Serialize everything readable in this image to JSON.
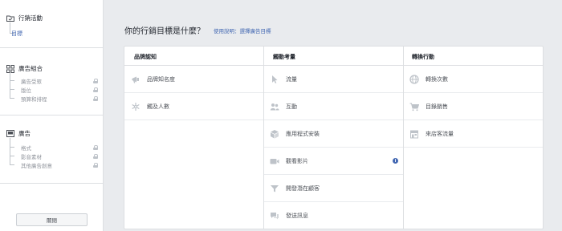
{
  "sidebar": {
    "campaign": {
      "title": "行銷活動",
      "items": [
        {
          "label": "目標"
        }
      ]
    },
    "adset": {
      "title": "廣告組合",
      "items": [
        {
          "label": "廣告受眾"
        },
        {
          "label": "版位"
        },
        {
          "label": "預算和排程"
        }
      ]
    },
    "ad": {
      "title": "廣告",
      "items": [
        {
          "label": "格式"
        },
        {
          "label": "影音素材"
        },
        {
          "label": "其他廣告創意"
        }
      ]
    },
    "close_label": "關閉"
  },
  "main": {
    "heading": "你的行銷目標是什麼？",
    "help_link": "使用說明：選擇廣告目標",
    "columns": [
      {
        "title": "品牌認知",
        "options": [
          {
            "label": "品牌知名度",
            "icon": "megaphone-icon"
          },
          {
            "label": "觸及人數",
            "icon": "snowflake-icon"
          }
        ]
      },
      {
        "title": "觸動考量",
        "options": [
          {
            "label": "流量",
            "icon": "cursor-icon"
          },
          {
            "label": "互動",
            "icon": "people-icon"
          },
          {
            "label": "應用程式安裝",
            "icon": "box-icon"
          },
          {
            "label": "觀看影片",
            "icon": "video-icon"
          },
          {
            "label": "開發潛在顧客",
            "icon": "funnel-icon"
          },
          {
            "label": "發送訊息",
            "icon": "chat-icon"
          }
        ]
      },
      {
        "title": "轉換行動",
        "options": [
          {
            "label": "轉換次數",
            "icon": "globe-icon"
          },
          {
            "label": "目錄銷售",
            "icon": "cart-icon"
          },
          {
            "label": "來店客流量",
            "icon": "store-icon"
          }
        ]
      }
    ],
    "info_icon": "i"
  },
  "colors": {
    "accent": "#4267b2",
    "icon": "#bec3c9",
    "border": "#dddfe2",
    "background": "#e9ebee"
  }
}
